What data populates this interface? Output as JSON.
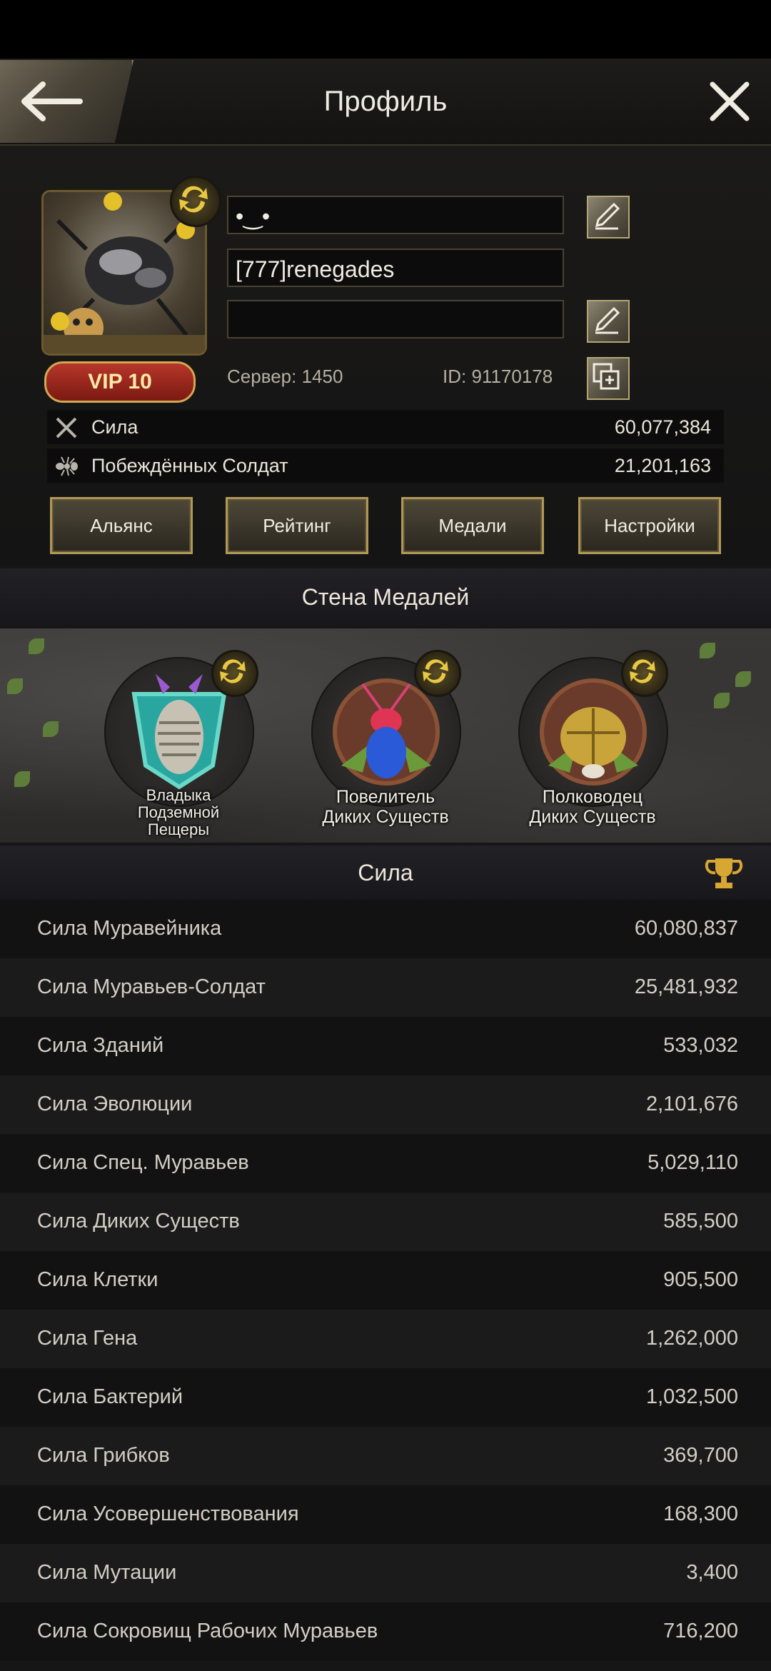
{
  "header": {
    "title": "Профиль"
  },
  "profile": {
    "nickname": "•‿•",
    "alliance_tag": "[777]renegades",
    "signature": "",
    "vip": "VIP 10",
    "server": "Сервер: 1450",
    "id": "ID: 91170178",
    "stats": [
      {
        "icon": "crossed-swords-icon",
        "label": "Сила",
        "value": "60,077,384"
      },
      {
        "icon": "ant-icon",
        "label": "Побеждённых Солдат",
        "value": "21,201,163"
      }
    ],
    "buttons": [
      "Альянс",
      "Рейтинг",
      "Медали",
      "Настройки"
    ]
  },
  "medal_wall": {
    "title": "Стена Медалей",
    "medals": [
      {
        "name_lines": [
          "Владыка",
          "Подземной",
          "Пещеры"
        ],
        "icon": "trilobite-medal-icon"
      },
      {
        "name_lines": [
          "Повелитель",
          "Диких Существ"
        ],
        "icon": "blue-beetle-medal-icon"
      },
      {
        "name_lines": [
          "Полководец",
          "Диких Существ"
        ],
        "icon": "golden-beetle-medal-icon"
      }
    ]
  },
  "power": {
    "title": "Сила",
    "rows": [
      {
        "label": "Сила Муравейника",
        "value": "60,080,837"
      },
      {
        "label": "Сила Муравьев-Солдат",
        "value": "25,481,932"
      },
      {
        "label": "Сила Зданий",
        "value": "533,032"
      },
      {
        "label": "Сила Эволюции",
        "value": "2,101,676"
      },
      {
        "label": "Сила Спец. Муравьев",
        "value": "5,029,110"
      },
      {
        "label": "Сила Диких Существ",
        "value": "585,500"
      },
      {
        "label": "Сила Клетки",
        "value": "905,500"
      },
      {
        "label": "Сила Гена",
        "value": "1,262,000"
      },
      {
        "label": "Сила Бактерий",
        "value": "1,032,500"
      },
      {
        "label": "Сила Грибков",
        "value": "369,700"
      },
      {
        "label": "Сила Усовершенствования",
        "value": "168,300"
      },
      {
        "label": "Сила Мутации",
        "value": "3,400"
      },
      {
        "label": "Сила Сокровищ Рабочих Муравьев",
        "value": "716,200"
      }
    ]
  },
  "colors": {
    "gold": "#b09858",
    "vip_red": "#9a2a1e",
    "panel": "#0c0c0c"
  }
}
